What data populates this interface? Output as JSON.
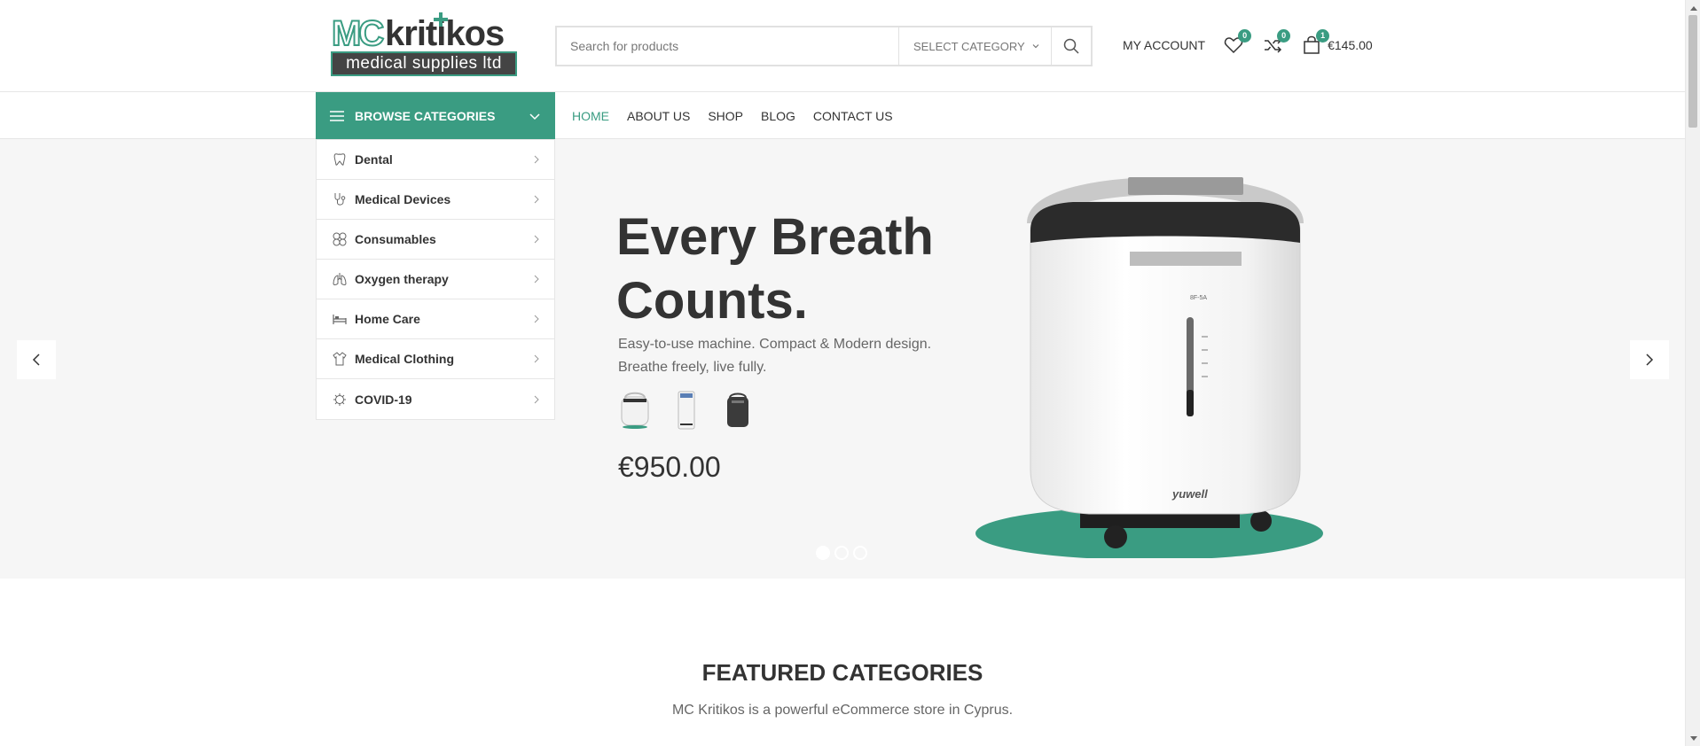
{
  "logo": {
    "mc": "MC",
    "brand": "kritikos",
    "tagline": "medical supplies ltd"
  },
  "search": {
    "placeholder": "Search for products",
    "category_label": "SELECT CATEGORY"
  },
  "header": {
    "account_label": "MY ACCOUNT",
    "wishlist_count": "0",
    "compare_count": "0",
    "cart_count": "1",
    "cart_total": "€145.00"
  },
  "nav": {
    "browse_label": "BROWSE CATEGORIES",
    "items": [
      {
        "label": "HOME"
      },
      {
        "label": "ABOUT US"
      },
      {
        "label": "SHOP"
      },
      {
        "label": "BLOG"
      },
      {
        "label": "CONTACT US"
      }
    ],
    "active": "HOME"
  },
  "categories": [
    {
      "label": "Dental",
      "icon": "tooth-icon"
    },
    {
      "label": "Medical Devices",
      "icon": "stethoscope-icon"
    },
    {
      "label": "Consumables",
      "icon": "pills-icon"
    },
    {
      "label": "Oxygen therapy",
      "icon": "lungs-icon"
    },
    {
      "label": "Home Care",
      "icon": "bed-icon"
    },
    {
      "label": "Medical Clothing",
      "icon": "coat-icon"
    },
    {
      "label": "COVID-19",
      "icon": "virus-icon"
    }
  ],
  "hero": {
    "headline": "Every Breath Counts.",
    "desc_line1": "Easy-to-use machine. Compact & Modern design.",
    "desc_line2": "Breathe freely, live fully.",
    "price": "€950.00",
    "product_brand": "yuwell",
    "product_model": "8F-5A",
    "slides": 3,
    "active_slide": 1
  },
  "featured": {
    "title": "FEATURED CATEGORIES",
    "subtitle": "MC Kritikos is a powerful eCommerce store in Cyprus."
  },
  "colors": {
    "accent": "#3a9c82",
    "text": "#333333",
    "hero_bg": "#f6f6f6"
  }
}
